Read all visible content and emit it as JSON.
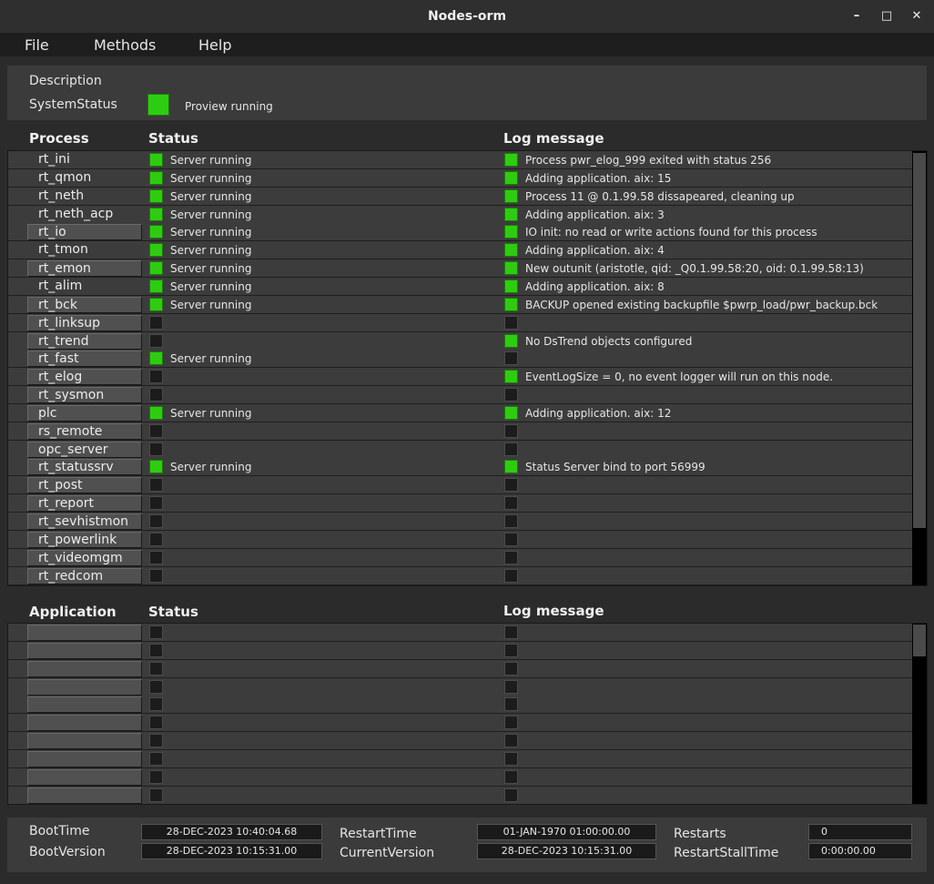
{
  "window": {
    "title": "Nodes-orm",
    "minimize": "–",
    "maximize": "□",
    "close": "✕"
  },
  "menu": [
    "File",
    "Methods",
    "Help"
  ],
  "description": {
    "label": "Description",
    "system_status_label": "SystemStatus",
    "system_status_text": "Proview running",
    "system_status_color": "#2ecc11"
  },
  "process_table": {
    "headers": {
      "name": "Process",
      "status": "Status",
      "log": "Log message"
    },
    "rows": [
      {
        "name": "rt_ini",
        "button": false,
        "status_on": true,
        "status": "Server running",
        "log_on": true,
        "log": "Process pwr_elog_999 exited with status 256"
      },
      {
        "name": "rt_qmon",
        "button": false,
        "status_on": true,
        "status": "Server running",
        "log_on": true,
        "log": "Adding application. aix: 15"
      },
      {
        "name": "rt_neth",
        "button": false,
        "status_on": true,
        "status": "Server running",
        "log_on": true,
        "log": "Process 11 @ 0.1.99.58 dissapeared, cleaning up"
      },
      {
        "name": "rt_neth_acp",
        "button": false,
        "status_on": true,
        "status": "Server running",
        "log_on": true,
        "log": "Adding application. aix: 3"
      },
      {
        "name": "rt_io",
        "button": true,
        "status_on": true,
        "status": "Server running",
        "log_on": true,
        "log": "IO init: no read or write actions found for this process"
      },
      {
        "name": "rt_tmon",
        "button": false,
        "status_on": true,
        "status": "Server running",
        "log_on": true,
        "log": "Adding application. aix: 4"
      },
      {
        "name": "rt_emon",
        "button": true,
        "status_on": true,
        "status": "Server running",
        "log_on": true,
        "log": "New outunit (aristotle, qid: _Q0.1.99.58:20, oid: 0.1.99.58:13)"
      },
      {
        "name": "rt_alim",
        "button": false,
        "status_on": true,
        "status": "Server running",
        "log_on": true,
        "log": "Adding application. aix: 8"
      },
      {
        "name": "rt_bck",
        "button": true,
        "status_on": true,
        "status": "Server running",
        "log_on": true,
        "log": "BACKUP opened existing backupfile $pwrp_load/pwr_backup.bck"
      },
      {
        "name": "rt_linksup",
        "button": true,
        "status_on": false,
        "status": "",
        "log_on": false,
        "log": ""
      },
      {
        "name": "rt_trend",
        "button": true,
        "status_on": false,
        "status": "",
        "log_on": true,
        "log": "No DsTrend objects configured"
      },
      {
        "name": "rt_fast",
        "button": true,
        "status_on": true,
        "status": "Server running",
        "log_on": false,
        "log": ""
      },
      {
        "name": "rt_elog",
        "button": true,
        "status_on": false,
        "status": "",
        "log_on": true,
        "log": "EventLogSize = 0, no event logger will run on this node."
      },
      {
        "name": "rt_sysmon",
        "button": true,
        "status_on": false,
        "status": "",
        "log_on": false,
        "log": ""
      },
      {
        "name": "plc",
        "button": true,
        "status_on": true,
        "status": "Server running",
        "log_on": true,
        "log": "Adding application. aix: 12"
      },
      {
        "name": "rs_remote",
        "button": true,
        "status_on": false,
        "status": "",
        "log_on": false,
        "log": ""
      },
      {
        "name": "opc_server",
        "button": true,
        "status_on": false,
        "status": "",
        "log_on": false,
        "log": ""
      },
      {
        "name": "rt_statussrv",
        "button": true,
        "status_on": true,
        "status": "Server running",
        "log_on": true,
        "log": "Status Server bind to port 56999"
      },
      {
        "name": "rt_post",
        "button": true,
        "status_on": false,
        "status": "",
        "log_on": false,
        "log": ""
      },
      {
        "name": "rt_report",
        "button": true,
        "status_on": false,
        "status": "",
        "log_on": false,
        "log": ""
      },
      {
        "name": "rt_sevhistmon",
        "button": true,
        "status_on": false,
        "status": "",
        "log_on": false,
        "log": ""
      },
      {
        "name": "rt_powerlink",
        "button": true,
        "status_on": false,
        "status": "",
        "log_on": false,
        "log": ""
      },
      {
        "name": "rt_videomgm",
        "button": true,
        "status_on": false,
        "status": "",
        "log_on": false,
        "log": ""
      },
      {
        "name": "rt_redcom",
        "button": true,
        "status_on": false,
        "status": "",
        "log_on": false,
        "log": ""
      }
    ]
  },
  "application_table": {
    "headers": {
      "name": "Application",
      "status": "Status",
      "log": "Log message"
    },
    "rows": [
      {
        "name": "",
        "button": true,
        "status_on": false,
        "status": "",
        "log_on": false,
        "log": ""
      },
      {
        "name": "",
        "button": true,
        "status_on": false,
        "status": "",
        "log_on": false,
        "log": ""
      },
      {
        "name": "",
        "button": true,
        "status_on": false,
        "status": "",
        "log_on": false,
        "log": ""
      },
      {
        "name": "",
        "button": true,
        "status_on": false,
        "status": "",
        "log_on": false,
        "log": ""
      },
      {
        "name": "",
        "button": true,
        "status_on": false,
        "status": "",
        "log_on": false,
        "log": ""
      },
      {
        "name": "",
        "button": true,
        "status_on": false,
        "status": "",
        "log_on": false,
        "log": ""
      },
      {
        "name": "",
        "button": true,
        "status_on": false,
        "status": "",
        "log_on": false,
        "log": ""
      },
      {
        "name": "",
        "button": true,
        "status_on": false,
        "status": "",
        "log_on": false,
        "log": ""
      },
      {
        "name": "",
        "button": true,
        "status_on": false,
        "status": "",
        "log_on": false,
        "log": ""
      },
      {
        "name": "",
        "button": true,
        "status_on": false,
        "status": "",
        "log_on": false,
        "log": ""
      }
    ]
  },
  "footer": {
    "boot_time_label": "BootTime",
    "boot_time": "28-DEC-2023 10:40:04.68",
    "boot_version_label": "BootVersion",
    "boot_version": "28-DEC-2023 10:15:31.00",
    "restart_time_label": "RestartTime",
    "restart_time": "01-JAN-1970 01:00:00.00",
    "current_version_label": "CurrentVersion",
    "current_version": "28-DEC-2023 10:15:31.00",
    "restarts_label": "Restarts",
    "restarts": "0",
    "restart_stall_time_label": "RestartStallTime",
    "restart_stall_time": "0:00:00.00"
  },
  "colors": {
    "on": "#2ecc11",
    "off": "#1c1c1c",
    "panel": "#3b3b3b",
    "background": "#2b2b2b"
  }
}
